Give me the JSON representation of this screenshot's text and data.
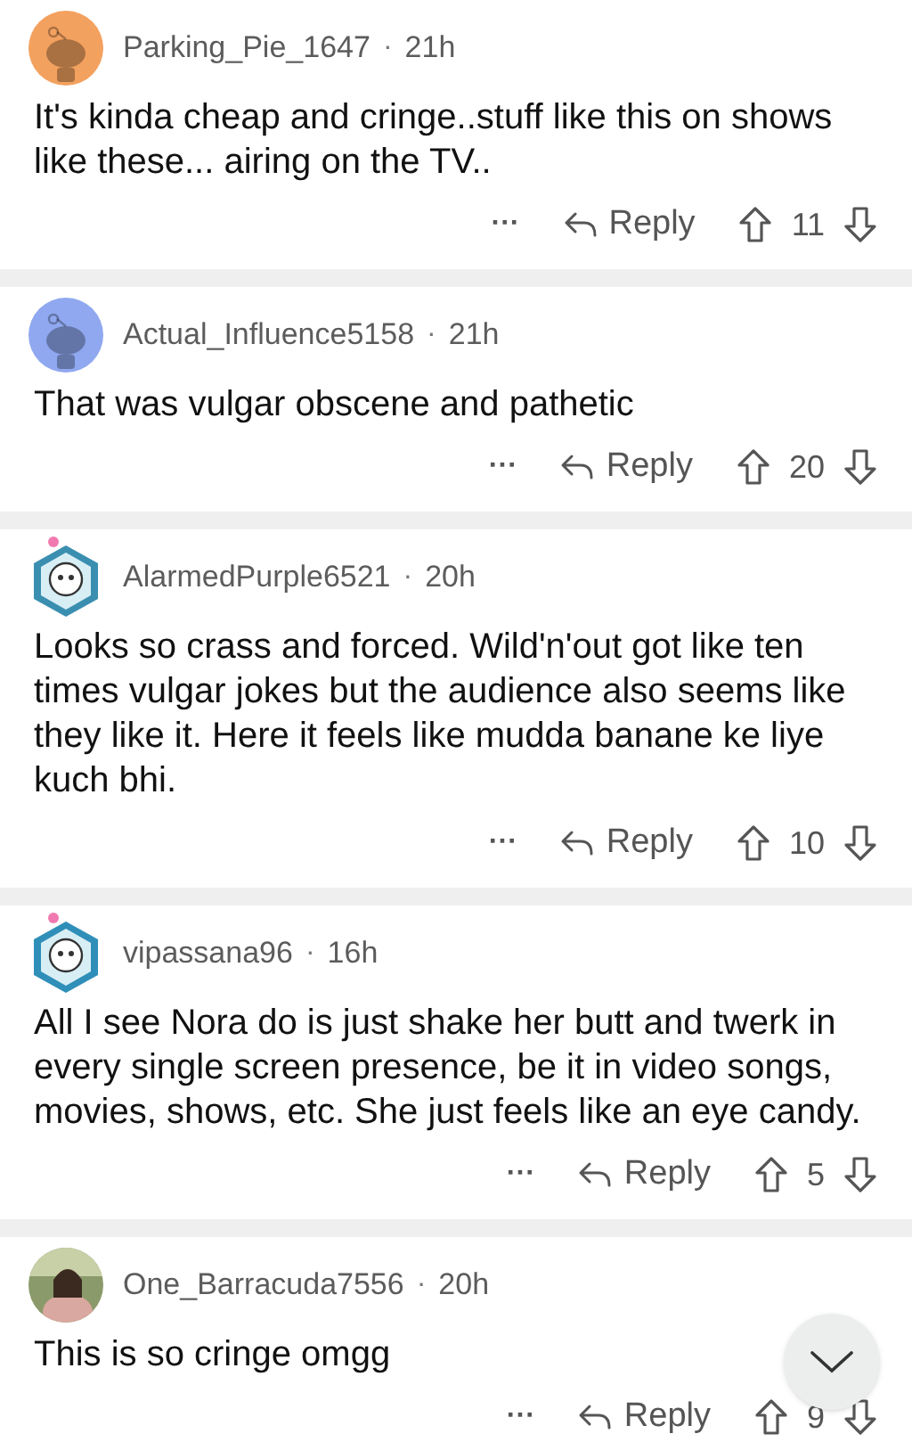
{
  "comments": [
    {
      "avatar": {
        "kind": "snoo",
        "color": "#f3a15f"
      },
      "username": "Parking_Pie_1647",
      "separator": "·",
      "time": "21h",
      "body": "It's kinda cheap and cringe..stuff like this on shows like these... airing on the TV..",
      "more": "···",
      "reply": "Reply",
      "score": "11"
    },
    {
      "avatar": {
        "kind": "snoo",
        "color": "#8fa8f0"
      },
      "username": "Actual_Influence5158",
      "separator": "·",
      "time": "21h",
      "body": "That was vulgar obscene and pathetic",
      "more": "···",
      "reply": "Reply",
      "score": "20"
    },
    {
      "avatar": {
        "kind": "hex",
        "color": "#3a8fb0"
      },
      "username": "AlarmedPurple6521",
      "separator": "·",
      "time": "20h",
      "body": "Looks so crass and forced. Wild'n'out got like ten times vulgar jokes but the audience also seems like they like it.  Here it feels like mudda banane ke liye kuch bhi.",
      "more": "···",
      "reply": "Reply",
      "score": "10"
    },
    {
      "avatar": {
        "kind": "hex",
        "color": "#2f8fb8"
      },
      "username": "vipassana96",
      "separator": "·",
      "time": "16h",
      "body": "All I see Nora do is just shake her butt and twerk in every single screen presence, be it in video songs, movies, shows, etc. She just feels like an eye candy.",
      "more": "···",
      "reply": "Reply",
      "score": "5"
    },
    {
      "username": "One_Barracuda7556",
      "separator": "·",
      "time": "20h",
      "body": "This is so cringe omgg",
      "more": "···",
      "reply": "Reply",
      "score": "9"
    }
  ]
}
